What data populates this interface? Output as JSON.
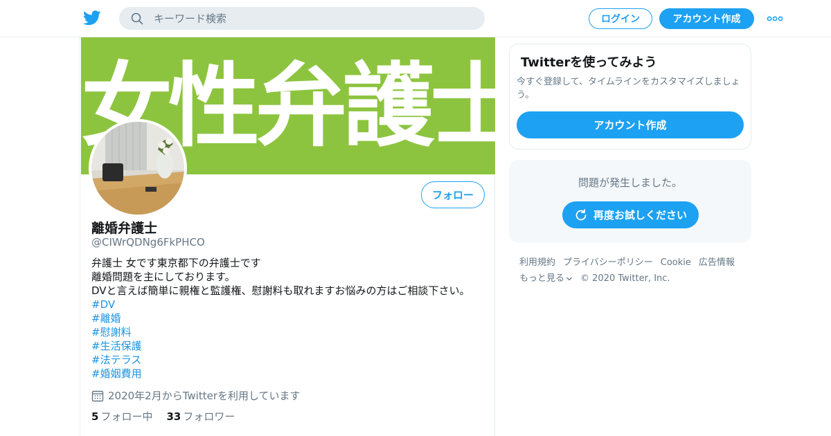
{
  "header": {
    "search_placeholder": "キーワード検索",
    "login_label": "ログイン",
    "signup_label": "アカウント作成"
  },
  "profile": {
    "banner_text": "女性弁護士",
    "name": "離婚弁護士",
    "handle": "@CIWrQDNg6FkPHCO",
    "follow_label": "フォロー",
    "bio_lines": [
      "弁護士 女です東京都下の弁護士です",
      "離婚問題を主にしております。",
      "DVと言えば簡単に親権と監護権、慰謝料も取れますお悩みの方はご相談下さい。"
    ],
    "hashtags": [
      "#DV",
      "#離婚",
      "#慰謝料",
      "#生活保護",
      "#法テラス",
      "#婚姻費用"
    ],
    "joined": "2020年2月からTwitterを利用しています",
    "following_count": "5",
    "following_label": "フォロー中",
    "followers_count": "33",
    "followers_label": "フォロワー"
  },
  "sidebar": {
    "try_title": "Twitterを使ってみよう",
    "try_subtitle": "今すぐ登録して、タイムラインをカスタマイズしましょう。",
    "try_button": "アカウント作成",
    "error_message": "問題が発生しました。",
    "retry_button": "再度お試しください"
  },
  "footer": {
    "links": [
      "利用規約",
      "プライバシーポリシー",
      "Cookie",
      "広告情報"
    ],
    "more_label": "もっと見る",
    "copyright": "© 2020 Twitter, Inc."
  },
  "colors": {
    "brand": "#1da1f2",
    "banner": "#8dc43f",
    "muted": "#657786",
    "hashtag": "#1b95e0"
  },
  "icons": [
    "twitter-logo-icon",
    "search-icon",
    "more-icon",
    "calendar-icon",
    "refresh-icon",
    "chevron-down-icon"
  ]
}
